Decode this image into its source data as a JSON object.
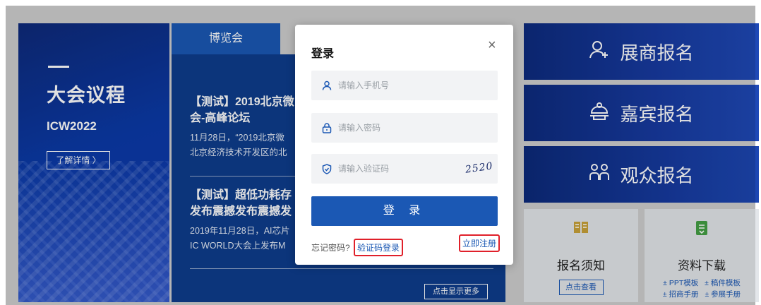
{
  "agenda": {
    "title": "大会议程",
    "subtitle": "ICW2022",
    "details_button": "了解详情 〉"
  },
  "news": {
    "tab_label": "博览会",
    "items": [
      {
        "headline_line1": "【测试】2019北京微",
        "headline_line2": "会-高峰论坛",
        "summary_line1": "11月28日，“2019北京微",
        "summary_line2": "北京经济技术开发区的北"
      },
      {
        "headline_line1": "【测试】超低功耗存",
        "headline_line2": "发布震撼发布震撼发",
        "summary_line1": "2019年11月28日，AI芯片",
        "summary_line2": "IC WORLD大会上发布M"
      }
    ],
    "more_button": "点击显示更多"
  },
  "tiles": {
    "exhibitor": "展商报名",
    "guest": "嘉宾报名",
    "audience": "观众报名"
  },
  "cards": {
    "notice": {
      "title": "报名须知",
      "button": "点击查看"
    },
    "downloads": {
      "title": "资料下载",
      "links": [
        "± PPT模板",
        "± 稿件模板",
        "± 招商手册",
        "± 参展手册"
      ]
    }
  },
  "login_modal": {
    "title": "登录",
    "close": "×",
    "phone_placeholder": "请输入手机号",
    "password_placeholder": "请输入密码",
    "captcha_placeholder": "请输入验证码",
    "captcha_text": "2520",
    "submit": "登 录",
    "forgot": "忘记密码?",
    "code_login": "验证码登录",
    "register": "立即注册"
  },
  "colors": {
    "primary": "#1b58b4",
    "highlight_red": "#e0202a"
  },
  "icons": {
    "exhibitor": "person-add-icon",
    "guest": "host-bell-icon",
    "audience": "group-icon",
    "notice": "book-icon",
    "downloads": "document-download-icon"
  }
}
